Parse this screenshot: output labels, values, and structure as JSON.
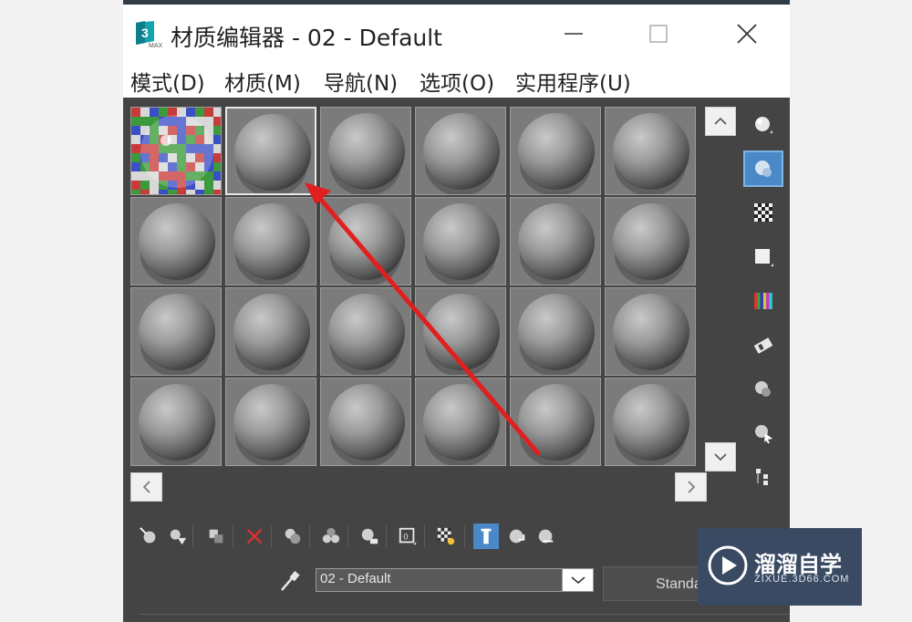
{
  "window": {
    "title": "材质编辑器 - 02 - Default",
    "app_icon": "3ds-max-icon",
    "controls": [
      "minimize-icon",
      "maximize-icon",
      "close-icon"
    ]
  },
  "menu": {
    "items": [
      "模式(D)",
      "材质(M)",
      "导航(N)",
      "选项(O)",
      "实用程序(U)"
    ]
  },
  "sample_slots": {
    "rows": 4,
    "columns": 6,
    "selected_index": 1,
    "checker_slot_index": 0
  },
  "side_toolbar": {
    "items": [
      {
        "name": "sample-type-icon",
        "active": false
      },
      {
        "name": "backlight-icon",
        "active": true
      },
      {
        "name": "background-checker-icon",
        "active": false
      },
      {
        "name": "sample-uv-tiling-icon",
        "active": false
      },
      {
        "name": "video-color-check-icon",
        "active": false
      },
      {
        "name": "make-preview-icon",
        "active": false
      },
      {
        "name": "material-options-icon",
        "active": false
      },
      {
        "name": "select-by-material-icon",
        "active": false
      },
      {
        "name": "material-map-navigator-icon",
        "active": false
      }
    ]
  },
  "bottom_toolbar": {
    "items": [
      {
        "name": "get-material-icon",
        "active": false
      },
      {
        "name": "put-to-scene-icon",
        "active": false
      },
      {
        "name": "assign-to-selection-icon",
        "active": false
      },
      {
        "name": "reset-map-icon",
        "active": false
      },
      {
        "name": "copy-material-icon",
        "active": false
      },
      {
        "name": "make-unique-icon",
        "active": false
      },
      {
        "name": "put-to-library-icon",
        "active": false
      },
      {
        "name": "material-id-channel-icon",
        "active": false
      },
      {
        "name": "show-map-in-viewport-icon",
        "active": false
      },
      {
        "name": "show-end-result-icon",
        "active": true
      },
      {
        "name": "go-to-parent-icon",
        "active": false
      },
      {
        "name": "go-forward-sibling-icon",
        "active": false
      }
    ]
  },
  "material_name": {
    "value": "02 - Default",
    "picker_icon": "eyedropper-icon",
    "type_button": "Standa"
  },
  "watermark": {
    "title": "溜溜自学",
    "subtitle": "ZIXUE.3D66.COM"
  },
  "colors": {
    "panel_bg": "#444444",
    "slot_bg": "#7b7b7b",
    "active_blue": "#4a88c7",
    "arrow_red": "#e0201f",
    "watermark_bg": "#394a62"
  }
}
